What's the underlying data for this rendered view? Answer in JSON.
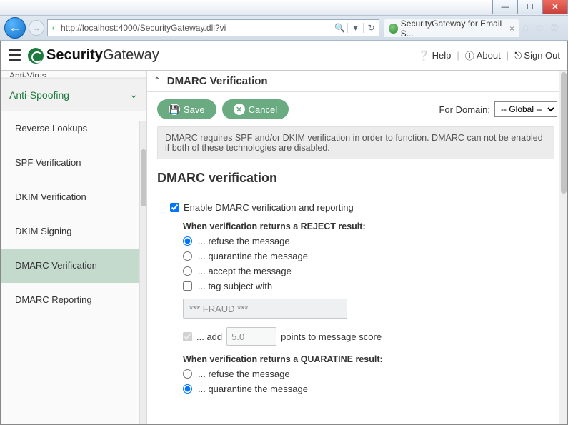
{
  "browser": {
    "url": "http://localhost:4000/SecurityGateway.dll?vi",
    "tab_title": "SecurityGateway for Email S..."
  },
  "header": {
    "brand_bold": "Security",
    "brand_light": "Gateway",
    "help": "Help",
    "about": "About",
    "signout": "Sign Out"
  },
  "sidebar": {
    "truncated_top": "Anti-Virus",
    "section": "Anti-Spoofing",
    "items": [
      {
        "label": "Reverse Lookups"
      },
      {
        "label": "SPF Verification"
      },
      {
        "label": "DKIM Verification"
      },
      {
        "label": "DKIM Signing"
      },
      {
        "label": "DMARC Verification"
      },
      {
        "label": "DMARC Reporting"
      }
    ],
    "active_index": 4
  },
  "main": {
    "title": "DMARC Verification",
    "save": "Save",
    "cancel": "Cancel",
    "for_domain_label": "For Domain:",
    "domain_value": "-- Global --",
    "notice": "DMARC requires SPF and/or DKIM verification in order to function. DMARC can not be enabled if both of these technologies are disabled.",
    "section_title": "DMARC verification",
    "enable_label": "Enable DMARC verification and reporting",
    "enable_checked": true,
    "reject": {
      "heading": "When verification returns a REJECT result:",
      "opt_refuse": "... refuse the message",
      "opt_quarantine": "... quarantine the message",
      "opt_accept": "... accept the message",
      "selected": "refuse",
      "tag_label": "... tag subject with",
      "tag_checked": false,
      "tag_value": "*** FRAUD ***",
      "add_label_pre": "... add",
      "add_label_post": "points to message score",
      "add_checked": true,
      "add_value": "5.0"
    },
    "quarantine": {
      "heading": "When verification returns a QUARATINE result:",
      "opt_refuse": "... refuse the message",
      "opt_quarantine": "... quarantine the message",
      "selected": "quarantine"
    }
  }
}
